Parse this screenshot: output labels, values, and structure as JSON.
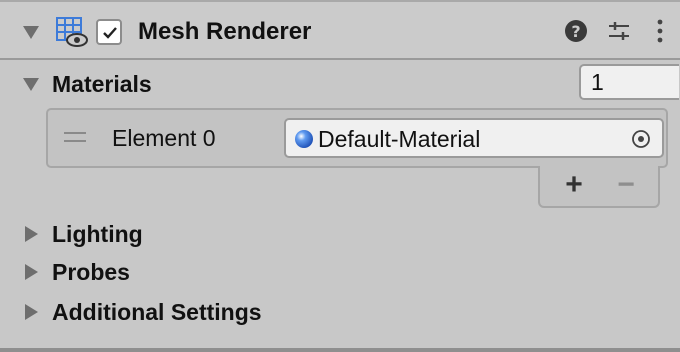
{
  "component": {
    "title": "Mesh Renderer",
    "enabled": true,
    "icons": {
      "component": "mesh-renderer-icon",
      "help": "help-icon",
      "presets": "presets-icon",
      "menu": "kebab-menu-icon"
    }
  },
  "materials": {
    "label": "Materials",
    "count": "1",
    "elements": [
      {
        "label": "Element 0",
        "value": "Default-Material",
        "icon": "material-sphere-icon"
      }
    ],
    "add_label": "+",
    "remove_label": "−"
  },
  "sections": [
    {
      "label": "Lighting",
      "expanded": false
    },
    {
      "label": "Probes",
      "expanded": false
    },
    {
      "label": "Additional Settings",
      "expanded": false
    }
  ],
  "colors": {
    "panel_bg": "#c8c8c8",
    "field_bg": "#f0f0f0",
    "accent_blue": "#2f6fe0",
    "icon_blue": "#3d7bd9"
  }
}
